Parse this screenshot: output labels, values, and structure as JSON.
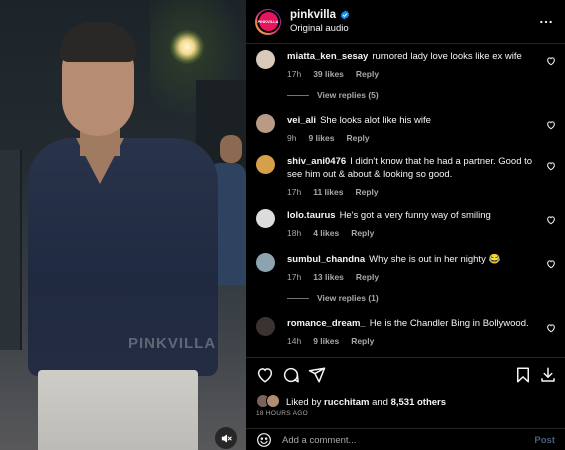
{
  "media": {
    "watermark": "PINKVILLA",
    "mute_icon": "speaker-muted-icon"
  },
  "header": {
    "avatar_text": "PINKVILLA",
    "username": "pinkvilla",
    "verified_icon": "verified-badge-icon",
    "subtitle": "Original audio",
    "more_icon": "more-options-icon"
  },
  "comments": [
    {
      "user": "miatta_ken_sesay",
      "text": "rumored lady love looks like ex wife",
      "time": "17h",
      "likes": "39 likes",
      "reply": "Reply",
      "avatar_color": "#d9c9b8",
      "view_replies": "View replies (5)"
    },
    {
      "user": "vei_ali",
      "text": "She looks alot like his wife",
      "time": "9h",
      "likes": "9 likes",
      "reply": "Reply",
      "avatar_color": "#b89a85",
      "view_replies": ""
    },
    {
      "user": "shiv_ani0476",
      "text": "I didn't know that he had a partner. Good to see him out & about & looking so good.",
      "time": "17h",
      "likes": "11 likes",
      "reply": "Reply",
      "avatar_color": "#d6a04a",
      "view_replies": ""
    },
    {
      "user": "lolo.taurus",
      "text": "He's got a very funny way of smiling",
      "time": "18h",
      "likes": "4 likes",
      "reply": "Reply",
      "avatar_color": "#dcdcdc",
      "view_replies": ""
    },
    {
      "user": "sumbul_chandna",
      "text": "Why she is out in her nighty 😂",
      "time": "17h",
      "likes": "13 likes",
      "reply": "Reply",
      "avatar_color": "#8da3b0",
      "view_replies": "View replies (1)"
    },
    {
      "user": "romance_dream_",
      "text": "He is the Chandler Bing in Bollywood.",
      "time": "14h",
      "likes": "9 likes",
      "reply": "Reply",
      "avatar_color": "#3a3330",
      "view_replies": ""
    }
  ],
  "actions": {
    "like_icon": "heart-icon",
    "comment_icon": "comment-icon",
    "share_icon": "share-icon",
    "save_icon": "bookmark-icon",
    "download_icon": "download-icon",
    "liked_prefix": "Liked by ",
    "liked_user": "rucchitam",
    "liked_middle": " and ",
    "liked_count": "8,531 others",
    "time_ago": "18 HOURS AGO"
  },
  "add_comment": {
    "emoji_icon": "emoji-icon",
    "placeholder": "Add a comment...",
    "post_label": "Post"
  },
  "colors": {
    "accent_post": "#4a5d7e",
    "verified_blue": "#0095f6",
    "brand_pink": "#e6155d"
  }
}
